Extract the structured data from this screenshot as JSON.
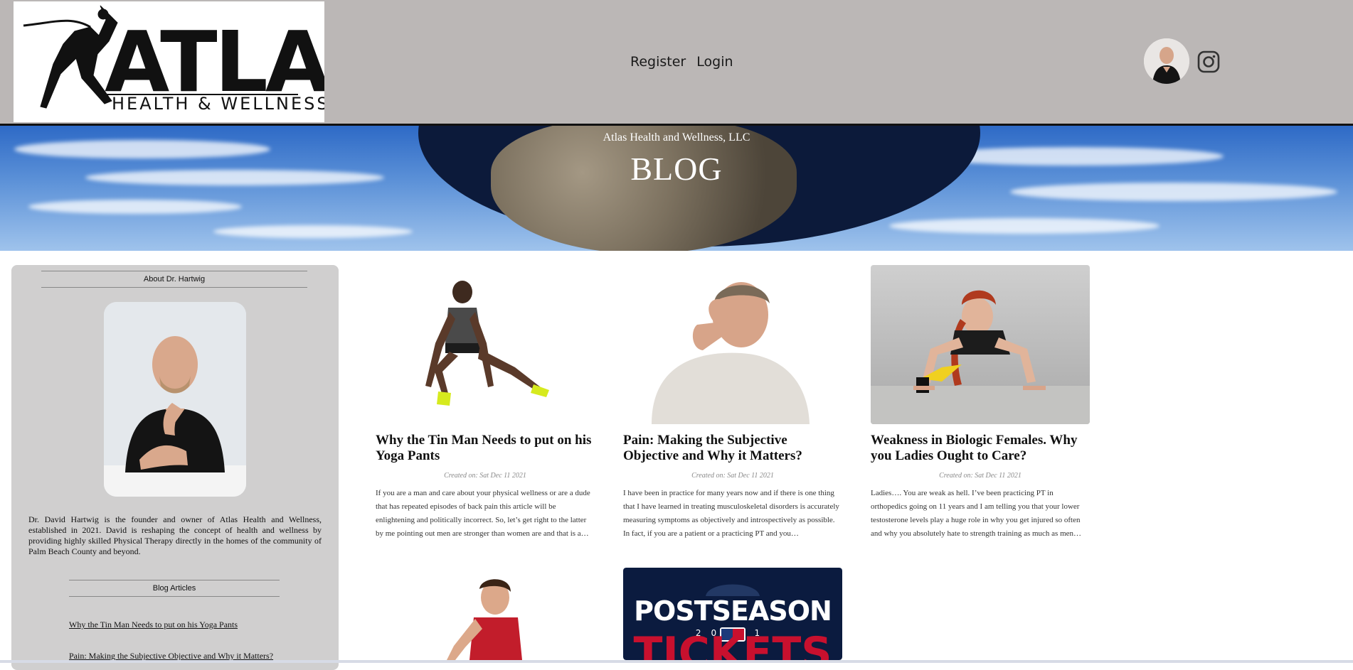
{
  "header": {
    "logo_text": "ATLAS",
    "logo_subtext": "HEALTH & WELLNESS",
    "nav": {
      "register": "Register",
      "login": "Login"
    }
  },
  "hero": {
    "subtitle": "Atlas Health and Wellness, LLC",
    "title": "BLOG"
  },
  "sidebar": {
    "about_heading": "About Dr. Hartwig",
    "bio": "Dr. David Hartwig is the founder and owner of Atlas Health and Wellness, established in 2021. David is reshaping the concept of health and wellness by providing highly skilled Physical Therapy directly in the homes of the community of Palm Beach County and beyond.",
    "articles_heading": "Blog Articles",
    "articles": [
      "Why the Tin Man Needs to put on his Yoga Pants",
      "Pain: Making the Subjective Objective and Why it Matters?"
    ]
  },
  "posts": [
    {
      "title": "Why the Tin Man Needs to put on his Yoga Pants",
      "date": "Created on: Sat Dec 11 2021",
      "excerpt": "If you are a man and care about your physical wellness or are a dude that has repeated episodes of back pain this article will be enlightening and politically incorrect. So, let’s get right to the latter by me pointing out men are stronger than women are and that is a…"
    },
    {
      "title": "Pain: Making the Subjective Objective and Why it Matters?",
      "date": "Created on: Sat Dec 11 2021",
      "excerpt": "I have been in practice for many years now and if there is one thing that I have learned in treating musculoskeletal disorders is accurately measuring symptoms as objectively and introspectively as possible. In fact, if you are a patient or a practicing PT and you…"
    },
    {
      "title": "Weakness in Biologic Females. Why you Ladies Ought to Care?",
      "date": "Created on: Sat Dec 11 2021",
      "excerpt": "Ladies…. You are weak as hell. I’ve been practicing PT in orthopedics going on 11 years and I am telling you that your lower testosterone levels play a huge role in why you get injured so often and why you absolutely hate to strength training as much as men…"
    }
  ],
  "postseason_image": {
    "line1": "POSTSEASON",
    "year": "20 21",
    "line2": "TICKETS"
  },
  "colors": {
    "header_bg": "#bbb7b6",
    "sidebar_bg": "#d0cfcf",
    "navy": "#0b1b3f",
    "mlb_red": "#c8102e"
  },
  "icons": [
    "avatar",
    "instagram-icon"
  ]
}
